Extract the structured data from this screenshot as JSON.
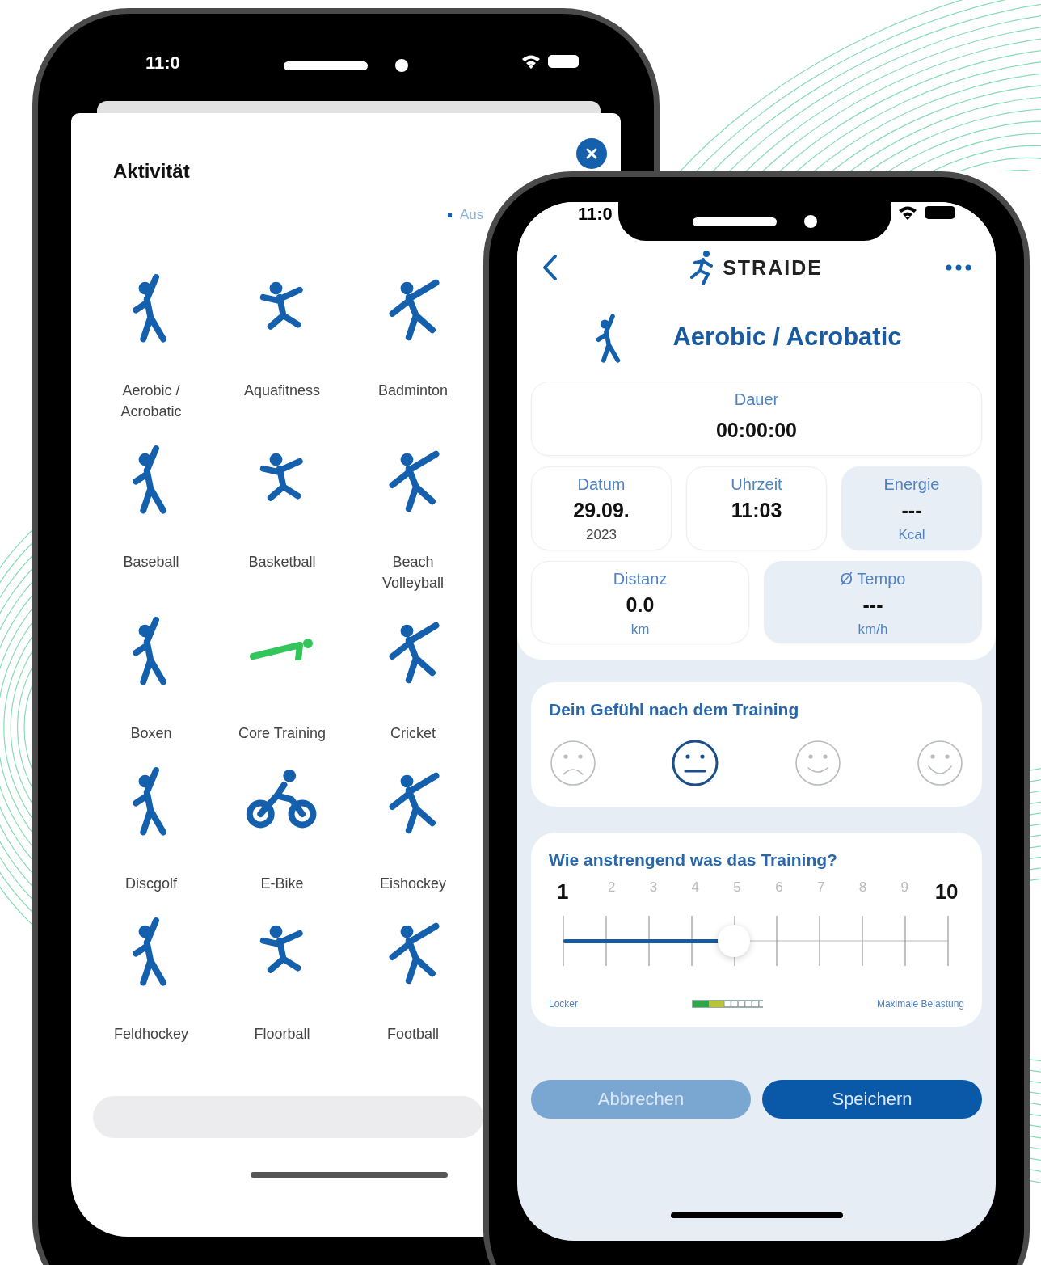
{
  "left_phone": {
    "status_bar": {
      "time": "11:0"
    },
    "sheet": {
      "title": "Aktivität",
      "link": "Aus",
      "activities": [
        {
          "label": "Aerobic /\nAcrobatic",
          "kind": "figure",
          "color": "#1560ad"
        },
        {
          "label": "Aquafitness",
          "kind": "figure",
          "color": "#1560ad"
        },
        {
          "label": "Badminton",
          "kind": "figure",
          "color": "#1560ad"
        },
        {
          "label": "Baseball",
          "kind": "figure",
          "color": "#1560ad"
        },
        {
          "label": "Basketball",
          "kind": "figure",
          "color": "#1560ad"
        },
        {
          "label": "Beach\nVolleyball",
          "kind": "figure",
          "color": "#1560ad"
        },
        {
          "label": "Boxen",
          "kind": "figure",
          "color": "#1560ad"
        },
        {
          "label": "Core Training",
          "kind": "plank",
          "color": "#33c45a"
        },
        {
          "label": "Cricket",
          "kind": "figure",
          "color": "#1560ad"
        },
        {
          "label": "Discgolf",
          "kind": "figure",
          "color": "#1560ad"
        },
        {
          "label": "E-Bike",
          "kind": "bike",
          "color": "#1560ad"
        },
        {
          "label": "Eishockey",
          "kind": "figure",
          "color": "#1560ad"
        },
        {
          "label": "Feldhockey",
          "kind": "figure",
          "color": "#1560ad"
        },
        {
          "label": "Floorball",
          "kind": "figure",
          "color": "#1560ad"
        },
        {
          "label": "Football",
          "kind": "figure",
          "color": "#1560ad"
        }
      ]
    }
  },
  "right_phone": {
    "status_bar": {
      "time": "11:0"
    },
    "header": {
      "brand": "STRAIDE"
    },
    "activity": {
      "title": "Aerobic / Acrobatic"
    },
    "duration": {
      "label": "Dauer",
      "value": "00:00:00"
    },
    "stats": [
      {
        "label": "Datum",
        "value": "29.09.",
        "unit": "2023",
        "disabled": false
      },
      {
        "label": "Uhrzeit",
        "value": "11:03",
        "disabled": false
      },
      {
        "label": "Energie",
        "value": "---",
        "unit": "Kcal",
        "disabled": true
      },
      {
        "label": "Distanz",
        "value": "0.0",
        "unit": "km",
        "disabled": false
      },
      {
        "label": "Ø Tempo",
        "value": "---",
        "unit": "km/h",
        "disabled": true
      }
    ],
    "feeling": {
      "title": "Dein Gefühl nach dem Training",
      "faces": [
        {
          "kind": "sad",
          "selected": false
        },
        {
          "kind": "neutral",
          "selected": true
        },
        {
          "kind": "smile",
          "selected": false
        },
        {
          "kind": "grin",
          "selected": false
        }
      ]
    },
    "effort": {
      "title": "Wie anstrengend was das Training?",
      "scale": [
        "1",
        "2",
        "3",
        "4",
        "5",
        "6",
        "7",
        "8",
        "9",
        "10"
      ],
      "level": 0.444,
      "min_label": "Locker",
      "max_label": "Maximale Belastung"
    },
    "buttons": [
      {
        "label": "Abbrechen",
        "kind": "secondary"
      },
      {
        "label": "Speichern",
        "kind": "primary"
      }
    ]
  }
}
